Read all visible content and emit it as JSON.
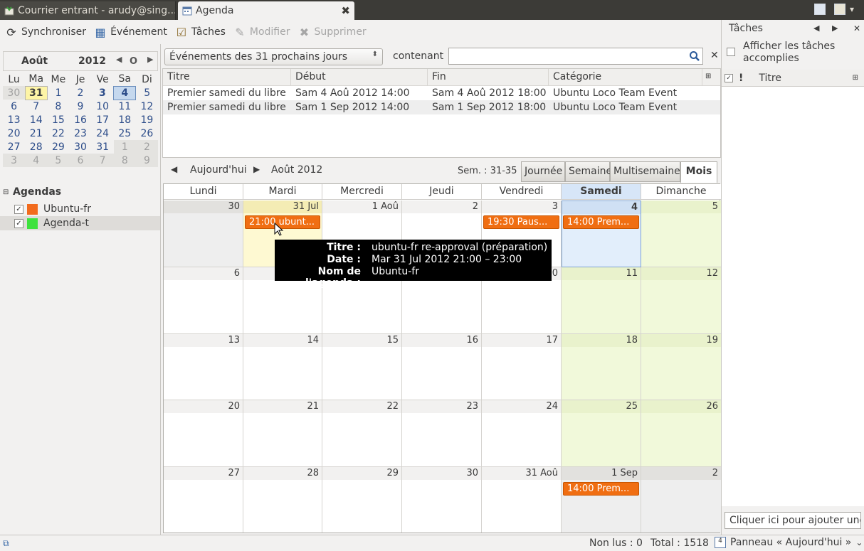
{
  "tabs": [
    {
      "label": "Courrier entrant - arudy@sing...",
      "active": false
    },
    {
      "label": "Agenda",
      "active": true
    }
  ],
  "toolbar": {
    "sync": "Synchroniser",
    "event": "Événement",
    "tasks": "Tâches",
    "modify": "Modifier",
    "delete": "Supprimer"
  },
  "minical": {
    "month": "Août",
    "year": "2012",
    "today_button": "O",
    "weekdays": [
      "Lu",
      "Ma",
      "Me",
      "Je",
      "Ve",
      "Sa",
      "Di"
    ],
    "weeks": [
      [
        "30",
        "31",
        "1",
        "2",
        "3",
        "4",
        "5"
      ],
      [
        "6",
        "7",
        "8",
        "9",
        "10",
        "11",
        "12"
      ],
      [
        "13",
        "14",
        "15",
        "16",
        "17",
        "18",
        "19"
      ],
      [
        "20",
        "21",
        "22",
        "23",
        "24",
        "25",
        "26"
      ],
      [
        "27",
        "28",
        "29",
        "30",
        "31",
        "1",
        "2"
      ],
      [
        "3",
        "4",
        "5",
        "6",
        "7",
        "8",
        "9"
      ]
    ]
  },
  "agendas": {
    "title": "Agendas",
    "items": [
      {
        "name": "Ubuntu-fr",
        "color": "#f26b1d",
        "checked": true
      },
      {
        "name": "Agenda-t",
        "color": "#3ee23e",
        "checked": true
      }
    ]
  },
  "filter": {
    "range": "Événements des 31 prochains jours",
    "containing": "contenant",
    "search_value": ""
  },
  "event_list": {
    "columns": [
      "Titre",
      "Début",
      "Fin",
      "Catégorie"
    ],
    "rows": [
      [
        "Premier samedi du libre",
        "Sam 4 Aoû 2012 14:00",
        "Sam 4 Aoû 2012 18:00",
        "Ubuntu Loco Team Event"
      ],
      [
        "Premier samedi du libre",
        "Sam 1 Sep 2012 14:00",
        "Sam 1 Sep 2012 18:00",
        "Ubuntu Loco Team Event"
      ]
    ]
  },
  "view_nav": {
    "today": "Aujourd'hui",
    "period": "Août 2012",
    "weeks": "Sem. : 31-35",
    "views": [
      "Journée",
      "Semaine",
      "Multisemaine",
      "Mois"
    ],
    "active_view": "Mois"
  },
  "month_view": {
    "days": [
      "Lundi",
      "Mardi",
      "Mercredi",
      "Jeudi",
      "Vendredi",
      "Samedi",
      "Dimanche"
    ],
    "weeks": [
      [
        "30",
        "31 Jul",
        "1 Aoû",
        "2",
        "3",
        "4",
        "5"
      ],
      [
        "6",
        "7",
        "8",
        "9",
        "10",
        "11",
        "12"
      ],
      [
        "13",
        "14",
        "15",
        "16",
        "17",
        "18",
        "19"
      ],
      [
        "20",
        "21",
        "22",
        "23",
        "24",
        "25",
        "26"
      ],
      [
        "27",
        "28",
        "29",
        "30",
        "31 Aoû",
        "1 Sep",
        "2"
      ]
    ],
    "events": [
      {
        "label": "21:00 ubunt...",
        "week": 0,
        "day": 1
      },
      {
        "label": "19:30 Paus...",
        "week": 0,
        "day": 4
      },
      {
        "label": "14:00 Prem...",
        "week": 0,
        "day": 5
      },
      {
        "label": "14:00 Prem...",
        "week": 4,
        "day": 5
      }
    ]
  },
  "tooltip": {
    "title_key": "Titre :",
    "title_val": "ubuntu-fr re-approval (préparation)",
    "date_key": "Date :",
    "date_val": "Mar 31 Jul 2012 21:00 – 23:00",
    "agenda_key": "Nom de l'agenda :",
    "agenda_val": "Ubuntu-fr"
  },
  "tasks_pane": {
    "title": "Tâches",
    "show_done": "Afficher les tâches accomplies",
    "column": "Titre",
    "add": "Cliquer ici pour ajouter une"
  },
  "status": {
    "unread": "Non lus : 0",
    "total": "Total : 1518",
    "panel": "Panneau « Aujourd'hui »"
  }
}
